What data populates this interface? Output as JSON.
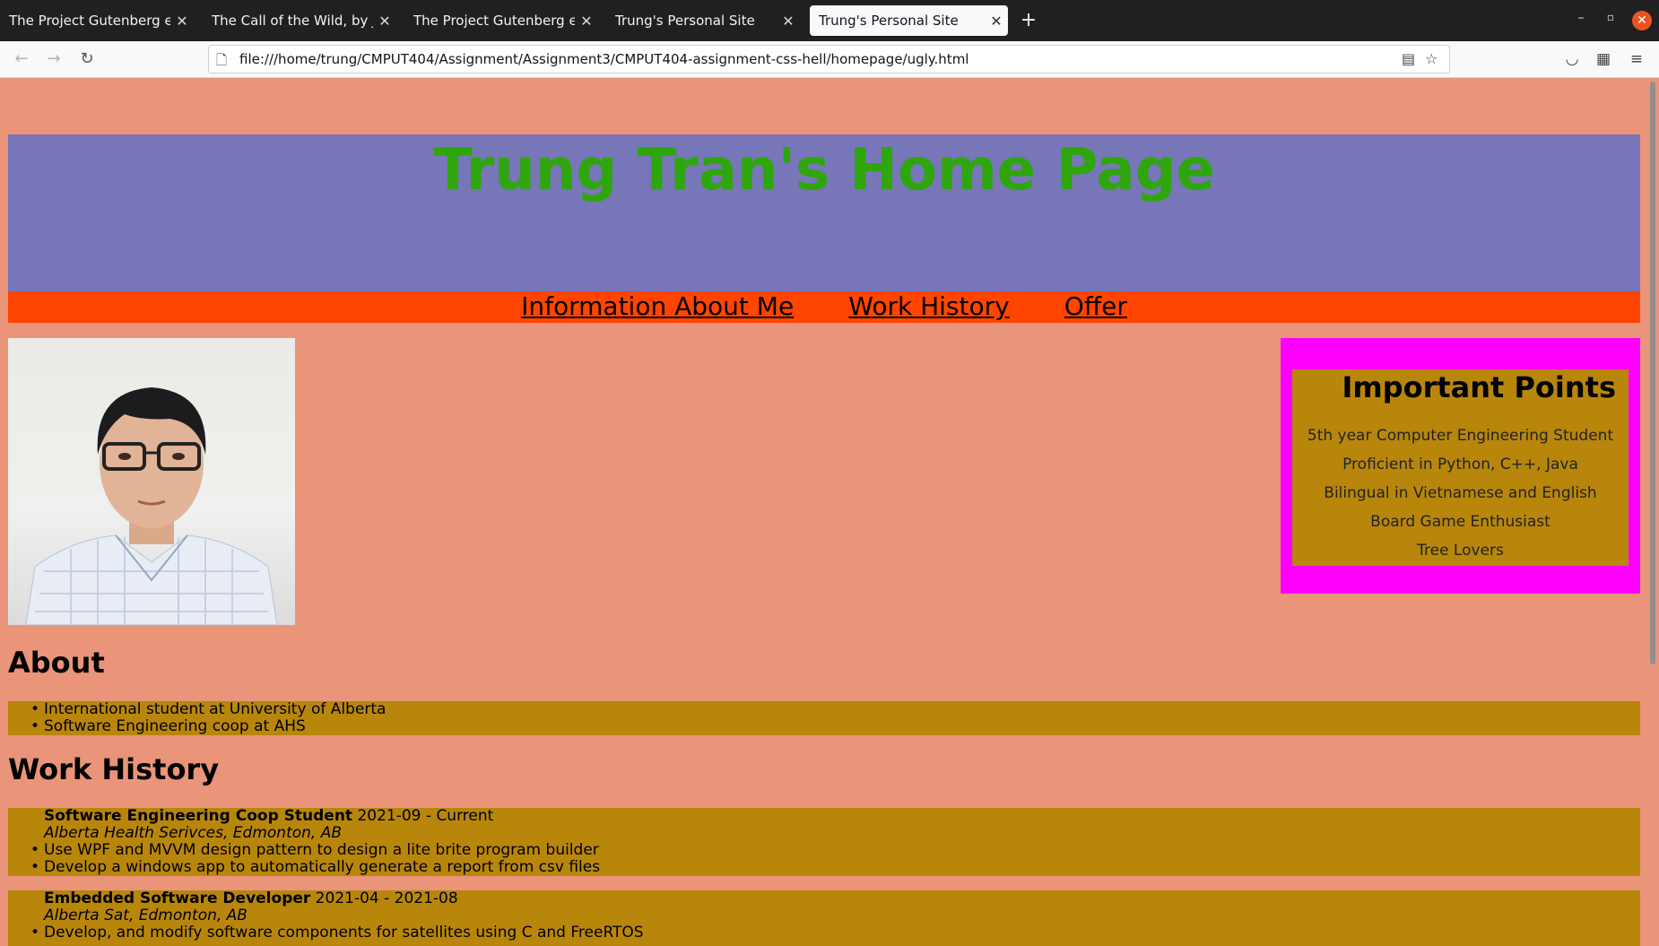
{
  "browser": {
    "tabs": [
      {
        "title": "The Project Gutenberg eBoo",
        "active": false
      },
      {
        "title": "The Call of the Wild, by Jack",
        "active": false
      },
      {
        "title": "The Project Gutenberg eBoo",
        "active": false
      },
      {
        "title": "Trung's Personal Site",
        "active": false
      },
      {
        "title": "Trung's Personal Site",
        "active": true
      }
    ],
    "url": "file:///home/trung/CMPUT404/Assignment/Assignment3/CMPUT404-assignment-css-hell/homepage/ugly.html"
  },
  "page": {
    "title": "Trung Tran's Home Page",
    "nav": [
      "Information About Me",
      "Work History",
      "Offer"
    ],
    "important": {
      "heading": "Important Points",
      "items": [
        "5th year Computer Engineering Student",
        "Proficient in Python, C++, Java",
        "Bilingual in Vietnamese and English",
        "Board Game Enthusiast",
        "Tree Lovers"
      ]
    },
    "about": {
      "heading": "About",
      "items": [
        "International student at University of Alberta",
        "Software Engineering coop at AHS"
      ]
    },
    "work": {
      "heading": "Work History",
      "jobs": [
        {
          "title": "Software Engineering Coop Student",
          "dates": " 2021-09 - Current",
          "place": "Alberta Health Serivces, Edmonton, AB",
          "bullets": [
            "Use WPF and MVVM design pattern to design a lite brite program builder",
            "Develop a windows app to automatically generate a report from csv files"
          ]
        },
        {
          "title": "Embedded Software Developer",
          "dates": " 2021-04 - 2021-08",
          "place": "Alberta Sat, Edmonton, AB",
          "bullets": [
            "Develop, and modify software components for satellites using C and FreeRTOS"
          ]
        }
      ]
    }
  }
}
